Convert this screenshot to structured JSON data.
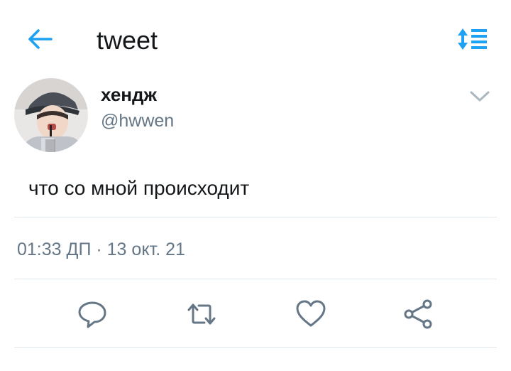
{
  "header": {
    "title": "tweet",
    "back_icon": "arrow-left-icon",
    "sort_icon": "sort-list-icon",
    "accent": "#1da1f2"
  },
  "tweet": {
    "author_name": "хендж",
    "author_handle": "@hwwen",
    "text": "что со мной происходит",
    "time": "01:33 ДП",
    "separator": "·",
    "date": "13 окт. 21",
    "menu_icon": "chevron-down-icon"
  },
  "actions": [
    {
      "icon": "reply-icon"
    },
    {
      "icon": "retweet-icon"
    },
    {
      "icon": "like-icon"
    },
    {
      "icon": "share-icon"
    }
  ],
  "colors": {
    "text": "#14171a",
    "secondary": "#657786",
    "divider": "#e1e8ed",
    "icon_gray": "#657786"
  }
}
